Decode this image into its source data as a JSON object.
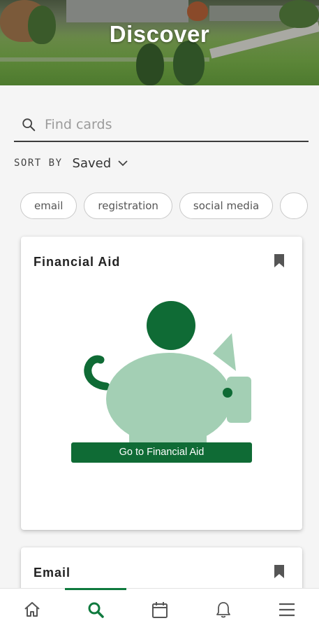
{
  "header": {
    "title": "Discover"
  },
  "search": {
    "placeholder": "Find cards",
    "value": ""
  },
  "sort": {
    "label": "SORT BY",
    "value": "Saved"
  },
  "chips": [
    "email",
    "registration",
    "social media",
    ""
  ],
  "cards": [
    {
      "title": "Financial Aid",
      "cta_label": "Go to Financial Aid",
      "icon": "piggy-bank-icon",
      "bookmarked": true
    },
    {
      "title": "Email",
      "bookmarked": true
    }
  ],
  "bottom_nav": {
    "items": [
      {
        "icon": "home-icon",
        "active": false
      },
      {
        "icon": "search-icon",
        "active": true
      },
      {
        "icon": "calendar-icon",
        "active": false
      },
      {
        "icon": "bell-icon",
        "active": false
      },
      {
        "icon": "menu-icon",
        "active": false
      }
    ]
  },
  "colors": {
    "brand_green": "#0f6b35",
    "piggy_light": "#a3cfb4",
    "coin_green": "#0f6b35",
    "icon_gray": "#555555"
  }
}
